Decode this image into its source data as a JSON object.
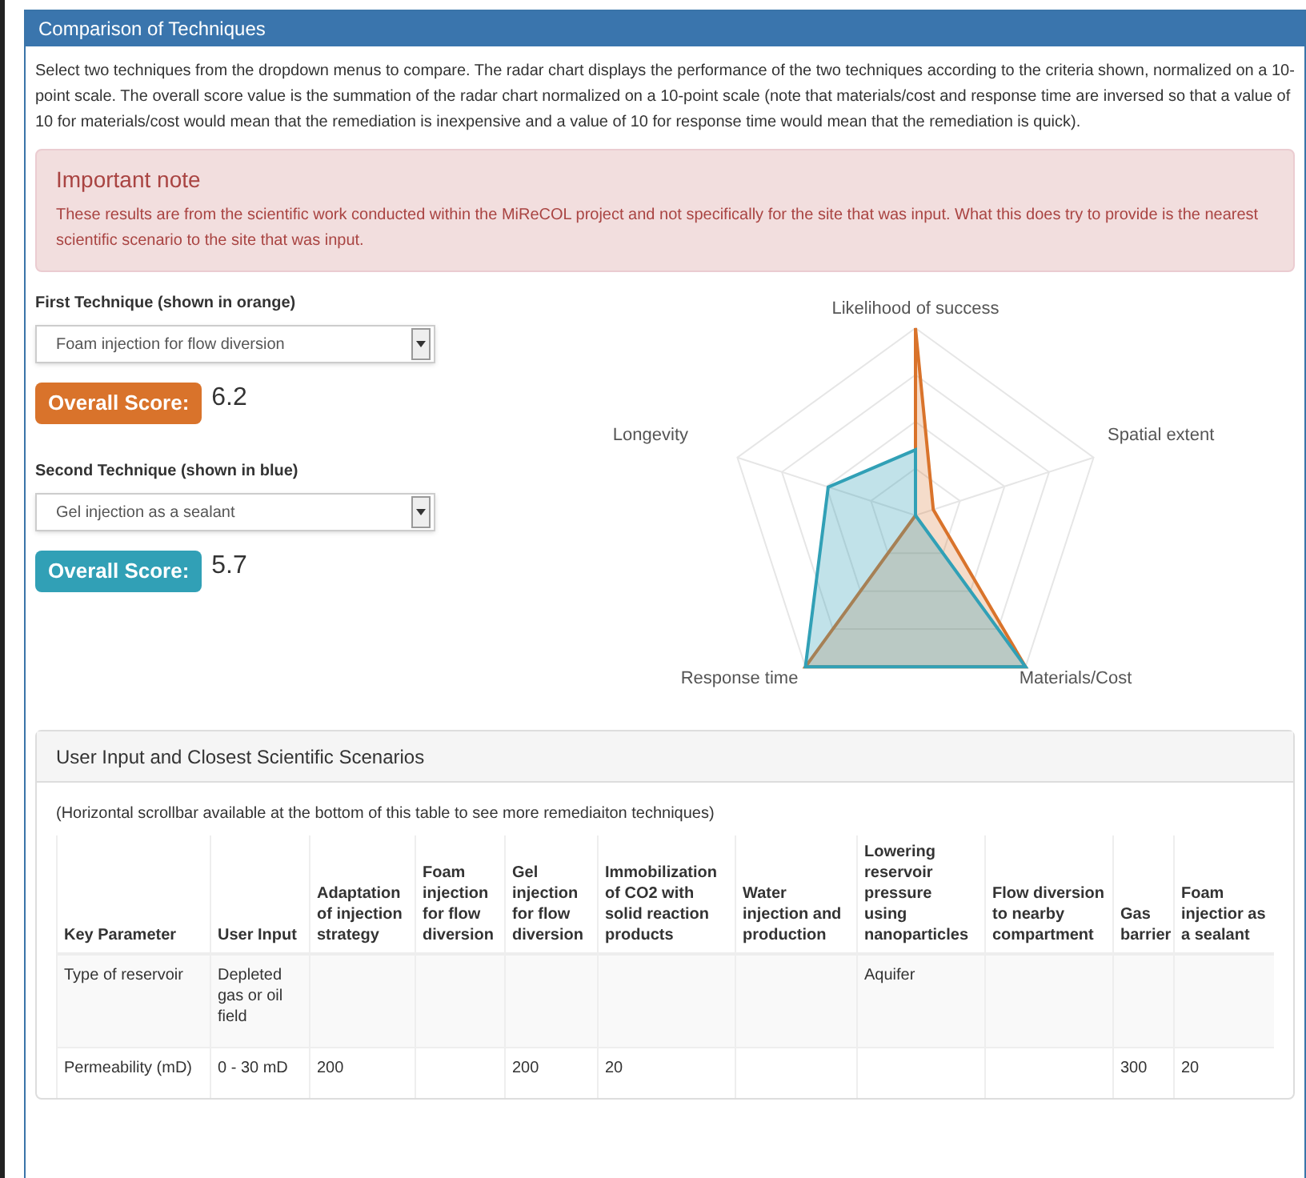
{
  "panel": {
    "title": "Comparison of Techniques"
  },
  "intro": "Select two techniques from the dropdown menus to compare. The radar chart displays the performance of the two techniques according to the criteria shown, normalized on a 10-point scale. The overall score value is the summation of the radar chart normalized on a 10-point scale (note that materials/cost and response time are inversed so that a value of 10 for materials/cost would mean that the remediation is inexpensive and a value of 10 for response time would mean that the remediation is quick).",
  "alert": {
    "title": "Important note",
    "text": "These results are from the scientific work conducted within the MiReCOL project and not specifically for the site that was input. What this does try to provide is the nearest scientific scenario to the site that was input."
  },
  "techniques": [
    {
      "label": "First Technique (shown in orange)",
      "value": "Foam injection for flow diversion",
      "score_label": "Overall Score:",
      "score": "6.2",
      "color": "#d9732b"
    },
    {
      "label": "Second Technique (shown in blue)",
      "value": "Gel injection as a sealant",
      "score_label": "Overall Score:",
      "score": "5.7",
      "color": "#31a0b6"
    }
  ],
  "radar": {
    "axes": [
      "Likelihood of success",
      "Spatial extent",
      "Materials/Cost",
      "Response time",
      "Longevity"
    ]
  },
  "scenarios": {
    "title": "User Input and Closest Scientific Scenarios",
    "note": "(Horizontal scrollbar available at the bottom of this table to see more remediaiton techniques)",
    "columns": [
      "Key Parameter",
      "User Input",
      "Adaptation of injection strategy",
      "Foam injection for flow diversion",
      "Gel injection for flow diversion",
      "Immobilization of CO2 with solid reaction products",
      "Water injection and production",
      "Lowering reservoir pressure using nanoparticles",
      "Flow diversion to nearby compartment",
      "Gas barrier",
      "Foam injectior as a sealant"
    ],
    "rows": [
      [
        "Type of reservoir",
        "Depleted gas or oil field",
        "",
        "",
        "",
        "",
        "",
        "Aquifer",
        "",
        "",
        ""
      ],
      [
        "Permeability (mD)",
        "0 - 30 mD",
        "200",
        "",
        "200",
        "20",
        "",
        "",
        "",
        "300",
        "20"
      ]
    ]
  }
}
